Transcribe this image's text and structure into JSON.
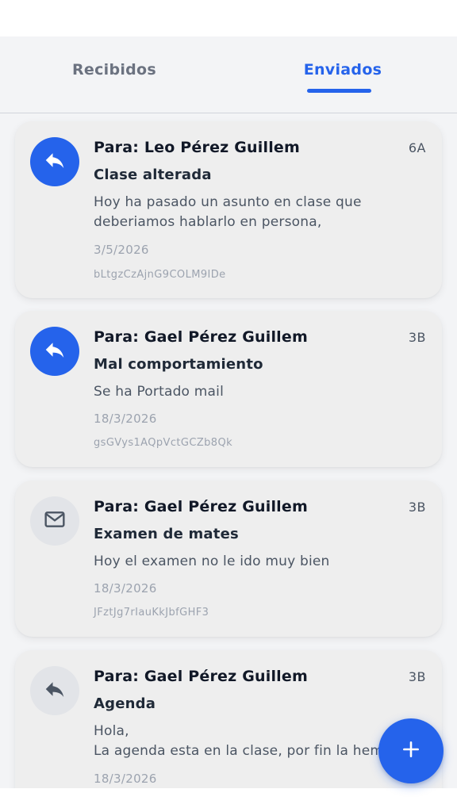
{
  "tabs": {
    "received_label": "Recibidos",
    "sent_label": "Enviados",
    "active": "sent"
  },
  "colors": {
    "accent": "#2563eb",
    "card_bg": "#eeeeee",
    "list_bg": "#f3f4f6"
  },
  "messages": [
    {
      "recipient": "Para: Leo Pérez Guillem",
      "grade": "6A",
      "subject": "Clase alterada",
      "body": "Hoy ha pasado un asunto en clase que\ndeberiamos hablarlo en persona,",
      "date": "3/5/2026",
      "id": "bLtgzCzAjnG9COLM9IDe",
      "icon": "reply-icon",
      "icon_style": "blue"
    },
    {
      "recipient": "Para: Gael Pérez Guillem",
      "grade": "3B",
      "subject": "Mal comportamiento",
      "body": "Se ha Portado mail",
      "date": "18/3/2026",
      "id": "gsGVys1AQpVctGCZb8Qk",
      "icon": "reply-icon",
      "icon_style": "blue"
    },
    {
      "recipient": "Para: Gael Pérez Guillem",
      "grade": "3B",
      "subject": "Examen de mates",
      "body": "Hoy el examen no le ido muy bien",
      "date": "18/3/2026",
      "id": "JFztJg7rIauKkJbfGHF3",
      "icon": "envelope-icon",
      "icon_style": "gray"
    },
    {
      "recipient": "Para: Gael Pérez Guillem",
      "grade": "3B",
      "subject": "Agenda",
      "body": "Hola,\nLa agenda esta en la clase, por fin la hemos",
      "date": "18/3/2026",
      "id": "",
      "icon": "reply-icon",
      "icon_style": "gray"
    }
  ],
  "fab": {
    "icon": "plus-icon"
  }
}
